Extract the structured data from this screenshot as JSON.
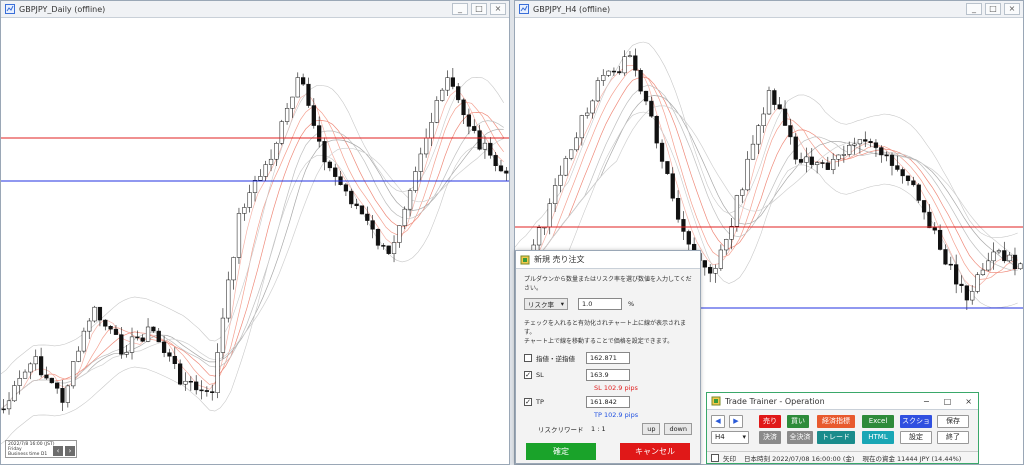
{
  "left_window": {
    "title": "GBPJPY_Daily (offline)",
    "info_lines": [
      "2022/7/8 16:00 (JST)",
      "Friday",
      "Business time     D1"
    ]
  },
  "right_window": {
    "title": "GBPJPY_H4 (offline)"
  },
  "order_dialog": {
    "title": "新規 売り注文",
    "description": "プルダウンから数量またはリスク率を選び数値を入力してください。",
    "risk_select": "リスク率",
    "risk_value": "1.0",
    "risk_unit": "%",
    "note_line1": "チェックを入れると有効化されチャート上に線が表示されます。",
    "note_line2": "チャート上で線を移動することで価格を設定できます。",
    "limit_label": "指値・逆指値",
    "limit_value": "162.871",
    "sl_label": "SL",
    "sl_value": "163.9",
    "sl_pips": "SL 102.9 pips",
    "tp_label": "TP",
    "tp_value": "161.842",
    "tp_pips": "TP 102.9 pips",
    "rr_label": "リスクリワード",
    "rr_value": "1 : 1",
    "up_label": "up",
    "down_label": "down",
    "confirm_label": "確定",
    "cancel_label": "キャンセル"
  },
  "trade_trainer": {
    "title": "Trade Trainer - Operation",
    "prev_icon": "◀",
    "next_icon": "▶",
    "sell": "売り",
    "buy": "買い",
    "settle_order": "経済指標",
    "excel": "Excel",
    "screenshot": "スクショ",
    "save": "保存",
    "timeframe": "H4",
    "settle": "決済",
    "settle_all": "全決済",
    "trade": "トレード",
    "html": "HTML",
    "settings": "設定",
    "exit": "終了",
    "status_arrow": "矢印",
    "status_time": "日本時刻 2022/07/08 16:00:00 (金)",
    "status_funds": "現在の資金 11444 JPY (14.44%)"
  },
  "colors": {
    "sl_line": "#e02020",
    "tp_line": "#2030e0",
    "confirm": "#1aa32a",
    "cancel": "#e01818",
    "sell": "#e01818",
    "buy": "#2e8b3a",
    "indicator": "#e85a2e",
    "excel": "#2e8b3a",
    "screenshot": "#3050e0",
    "settle": "#8a8a8a",
    "trade": "#1a8c8c",
    "html": "#19a6b5"
  }
}
